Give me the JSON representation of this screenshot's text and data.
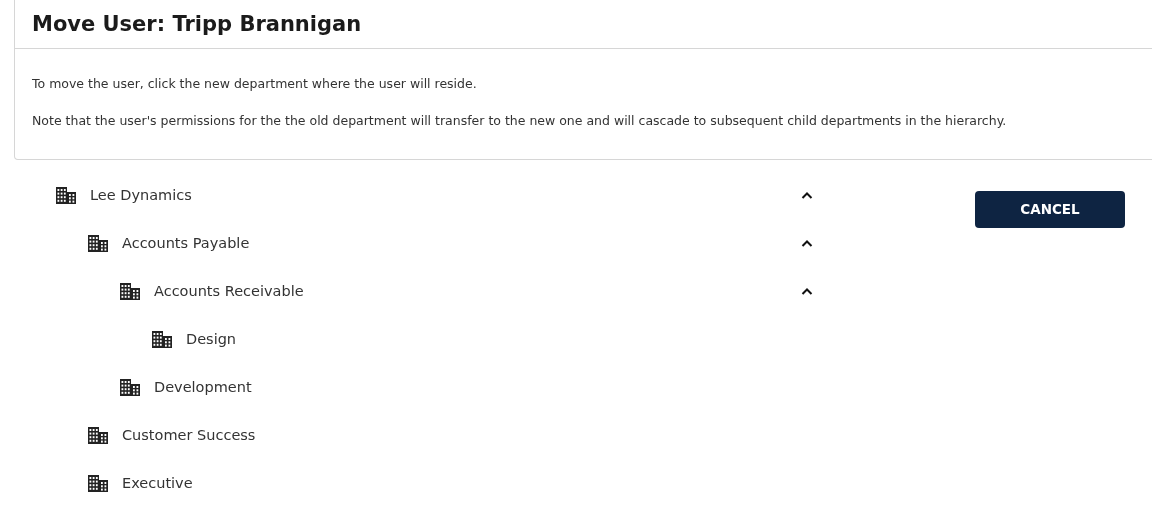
{
  "header": {
    "title": "Move User: Tripp Brannigan"
  },
  "instructions": [
    "To move the user, click the new department where the user will reside.",
    "Note that the user's permissions for the the old department will transfer to the new one and will cascade to subsequent child departments in the hierarchy."
  ],
  "tree": [
    {
      "label": "Lee Dynamics",
      "expanded": true,
      "children": [
        {
          "label": "Accounts Payable",
          "expanded": true,
          "children": [
            {
              "label": "Accounts Receivable",
              "expanded": true,
              "children": [
                {
                  "label": "Design"
                }
              ]
            },
            {
              "label": "Development"
            }
          ]
        },
        {
          "label": "Customer Success"
        },
        {
          "label": "Executive"
        }
      ]
    }
  ],
  "cancel_button": "CANCEL"
}
